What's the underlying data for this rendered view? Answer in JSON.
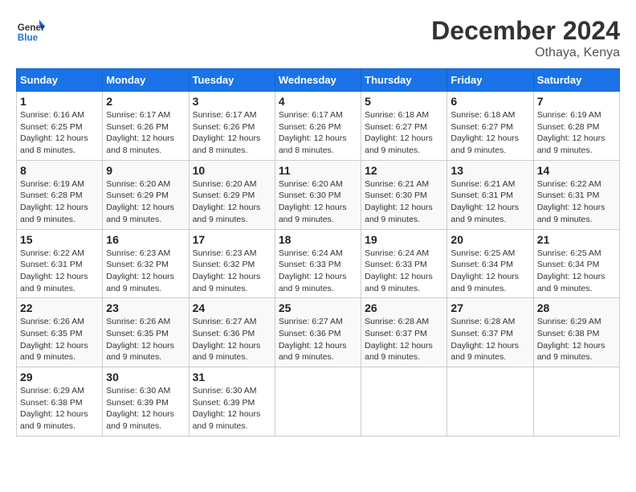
{
  "logo": {
    "general": "General",
    "blue": "Blue"
  },
  "title": "December 2024",
  "location": "Othaya, Kenya",
  "days_of_week": [
    "Sunday",
    "Monday",
    "Tuesday",
    "Wednesday",
    "Thursday",
    "Friday",
    "Saturday"
  ],
  "weeks": [
    [
      {
        "day": "1",
        "sunrise": "6:16 AM",
        "sunset": "6:25 PM",
        "daylight": "12 hours and 8 minutes."
      },
      {
        "day": "2",
        "sunrise": "6:17 AM",
        "sunset": "6:26 PM",
        "daylight": "12 hours and 8 minutes."
      },
      {
        "day": "3",
        "sunrise": "6:17 AM",
        "sunset": "6:26 PM",
        "daylight": "12 hours and 8 minutes."
      },
      {
        "day": "4",
        "sunrise": "6:17 AM",
        "sunset": "6:26 PM",
        "daylight": "12 hours and 8 minutes."
      },
      {
        "day": "5",
        "sunrise": "6:18 AM",
        "sunset": "6:27 PM",
        "daylight": "12 hours and 9 minutes."
      },
      {
        "day": "6",
        "sunrise": "6:18 AM",
        "sunset": "6:27 PM",
        "daylight": "12 hours and 9 minutes."
      },
      {
        "day": "7",
        "sunrise": "6:19 AM",
        "sunset": "6:28 PM",
        "daylight": "12 hours and 9 minutes."
      }
    ],
    [
      {
        "day": "8",
        "sunrise": "6:19 AM",
        "sunset": "6:28 PM",
        "daylight": "12 hours and 9 minutes."
      },
      {
        "day": "9",
        "sunrise": "6:20 AM",
        "sunset": "6:29 PM",
        "daylight": "12 hours and 9 minutes."
      },
      {
        "day": "10",
        "sunrise": "6:20 AM",
        "sunset": "6:29 PM",
        "daylight": "12 hours and 9 minutes."
      },
      {
        "day": "11",
        "sunrise": "6:20 AM",
        "sunset": "6:30 PM",
        "daylight": "12 hours and 9 minutes."
      },
      {
        "day": "12",
        "sunrise": "6:21 AM",
        "sunset": "6:30 PM",
        "daylight": "12 hours and 9 minutes."
      },
      {
        "day": "13",
        "sunrise": "6:21 AM",
        "sunset": "6:31 PM",
        "daylight": "12 hours and 9 minutes."
      },
      {
        "day": "14",
        "sunrise": "6:22 AM",
        "sunset": "6:31 PM",
        "daylight": "12 hours and 9 minutes."
      }
    ],
    [
      {
        "day": "15",
        "sunrise": "6:22 AM",
        "sunset": "6:31 PM",
        "daylight": "12 hours and 9 minutes."
      },
      {
        "day": "16",
        "sunrise": "6:23 AM",
        "sunset": "6:32 PM",
        "daylight": "12 hours and 9 minutes."
      },
      {
        "day": "17",
        "sunrise": "6:23 AM",
        "sunset": "6:32 PM",
        "daylight": "12 hours and 9 minutes."
      },
      {
        "day": "18",
        "sunrise": "6:24 AM",
        "sunset": "6:33 PM",
        "daylight": "12 hours and 9 minutes."
      },
      {
        "day": "19",
        "sunrise": "6:24 AM",
        "sunset": "6:33 PM",
        "daylight": "12 hours and 9 minutes."
      },
      {
        "day": "20",
        "sunrise": "6:25 AM",
        "sunset": "6:34 PM",
        "daylight": "12 hours and 9 minutes."
      },
      {
        "day": "21",
        "sunrise": "6:25 AM",
        "sunset": "6:34 PM",
        "daylight": "12 hours and 9 minutes."
      }
    ],
    [
      {
        "day": "22",
        "sunrise": "6:26 AM",
        "sunset": "6:35 PM",
        "daylight": "12 hours and 9 minutes."
      },
      {
        "day": "23",
        "sunrise": "6:26 AM",
        "sunset": "6:35 PM",
        "daylight": "12 hours and 9 minutes."
      },
      {
        "day": "24",
        "sunrise": "6:27 AM",
        "sunset": "6:36 PM",
        "daylight": "12 hours and 9 minutes."
      },
      {
        "day": "25",
        "sunrise": "6:27 AM",
        "sunset": "6:36 PM",
        "daylight": "12 hours and 9 minutes."
      },
      {
        "day": "26",
        "sunrise": "6:28 AM",
        "sunset": "6:37 PM",
        "daylight": "12 hours and 9 minutes."
      },
      {
        "day": "27",
        "sunrise": "6:28 AM",
        "sunset": "6:37 PM",
        "daylight": "12 hours and 9 minutes."
      },
      {
        "day": "28",
        "sunrise": "6:29 AM",
        "sunset": "6:38 PM",
        "daylight": "12 hours and 9 minutes."
      }
    ],
    [
      {
        "day": "29",
        "sunrise": "6:29 AM",
        "sunset": "6:38 PM",
        "daylight": "12 hours and 9 minutes."
      },
      {
        "day": "30",
        "sunrise": "6:30 AM",
        "sunset": "6:39 PM",
        "daylight": "12 hours and 9 minutes."
      },
      {
        "day": "31",
        "sunrise": "6:30 AM",
        "sunset": "6:39 PM",
        "daylight": "12 hours and 9 minutes."
      },
      null,
      null,
      null,
      null
    ]
  ],
  "labels": {
    "sunrise": "Sunrise:",
    "sunset": "Sunset:",
    "daylight": "Daylight:"
  }
}
